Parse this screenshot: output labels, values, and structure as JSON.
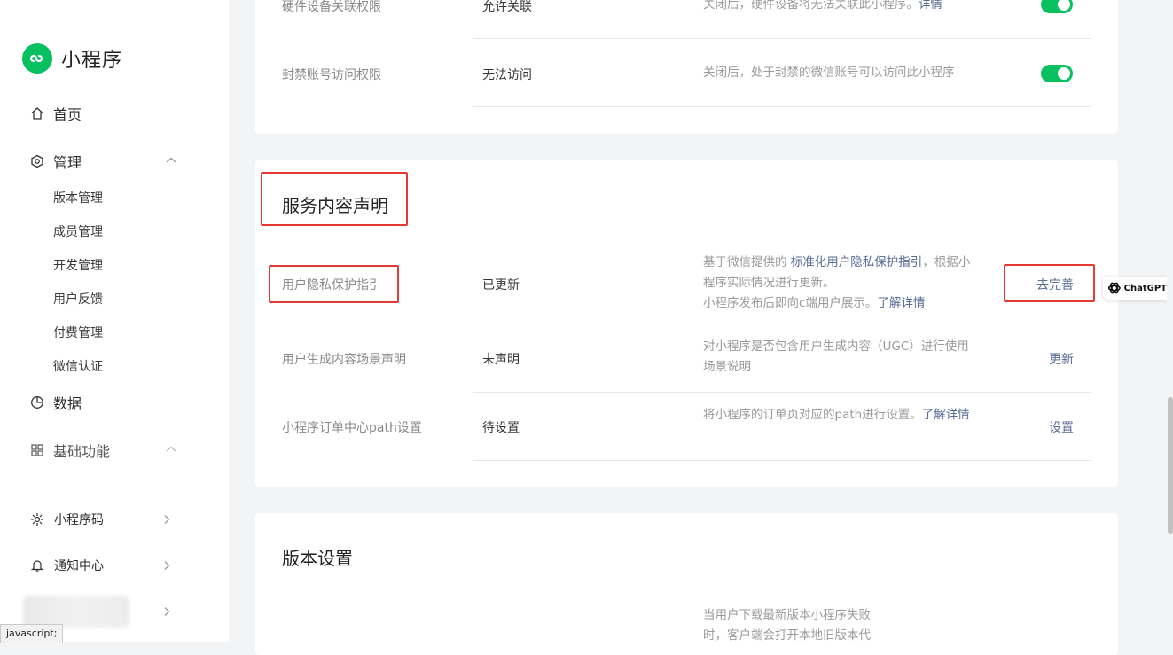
{
  "sidebar": {
    "logo_text": "小程序",
    "home": "首页",
    "manage": "管理",
    "manage_items": [
      "版本管理",
      "成员管理",
      "开发管理",
      "用户反馈",
      "付费管理",
      "微信认证"
    ],
    "data": "数据",
    "basic": "基础功能",
    "qrcode": "小程序码",
    "notify": "通知中心"
  },
  "permissions": {
    "row1": {
      "label": "硬件设备关联权限",
      "status": "允许关联",
      "desc": "关闭后，硬件设备将无法关联此小程序。",
      "desc_link": "详情",
      "enabled": true
    },
    "row2": {
      "label": "封禁账号访问权限",
      "status": "无法访问",
      "desc": "关闭后，处于封禁的微信账号可以访问此小程序",
      "enabled": true
    }
  },
  "service": {
    "title": "服务内容声明",
    "row1": {
      "label": "用户隐私保护指引",
      "status": "已更新",
      "desc_a": "基于微信提供的 ",
      "desc_link": "标准化用户隐私保护指引",
      "desc_b": "，根据小程序实际情况进行更新。",
      "desc_c": "小程序发布后即向c端用户展示。",
      "desc_link2": "了解详情",
      "action": "去完善"
    },
    "row2": {
      "label": "用户生成内容场景声明",
      "status": "未声明",
      "desc": "对小程序是否包含用户生成内容（UGC）进行使用场景说明",
      "action": "更新"
    },
    "row3": {
      "label": "小程序订单中心path设置",
      "status": "待设置",
      "desc": "将小程序的订单页对应的path进行设置。",
      "desc_link": "了解详情",
      "action": "设置"
    }
  },
  "version": {
    "title": "版本设置",
    "desc": "当用户下载最新版本小程序失败时，客户端会打开本地旧版本代"
  },
  "status_bar": "javascript;",
  "extension_badge": "ChatGPT",
  "colors": {
    "brand": "#07c160",
    "link": "#576b95",
    "highlight": "#e53935"
  }
}
